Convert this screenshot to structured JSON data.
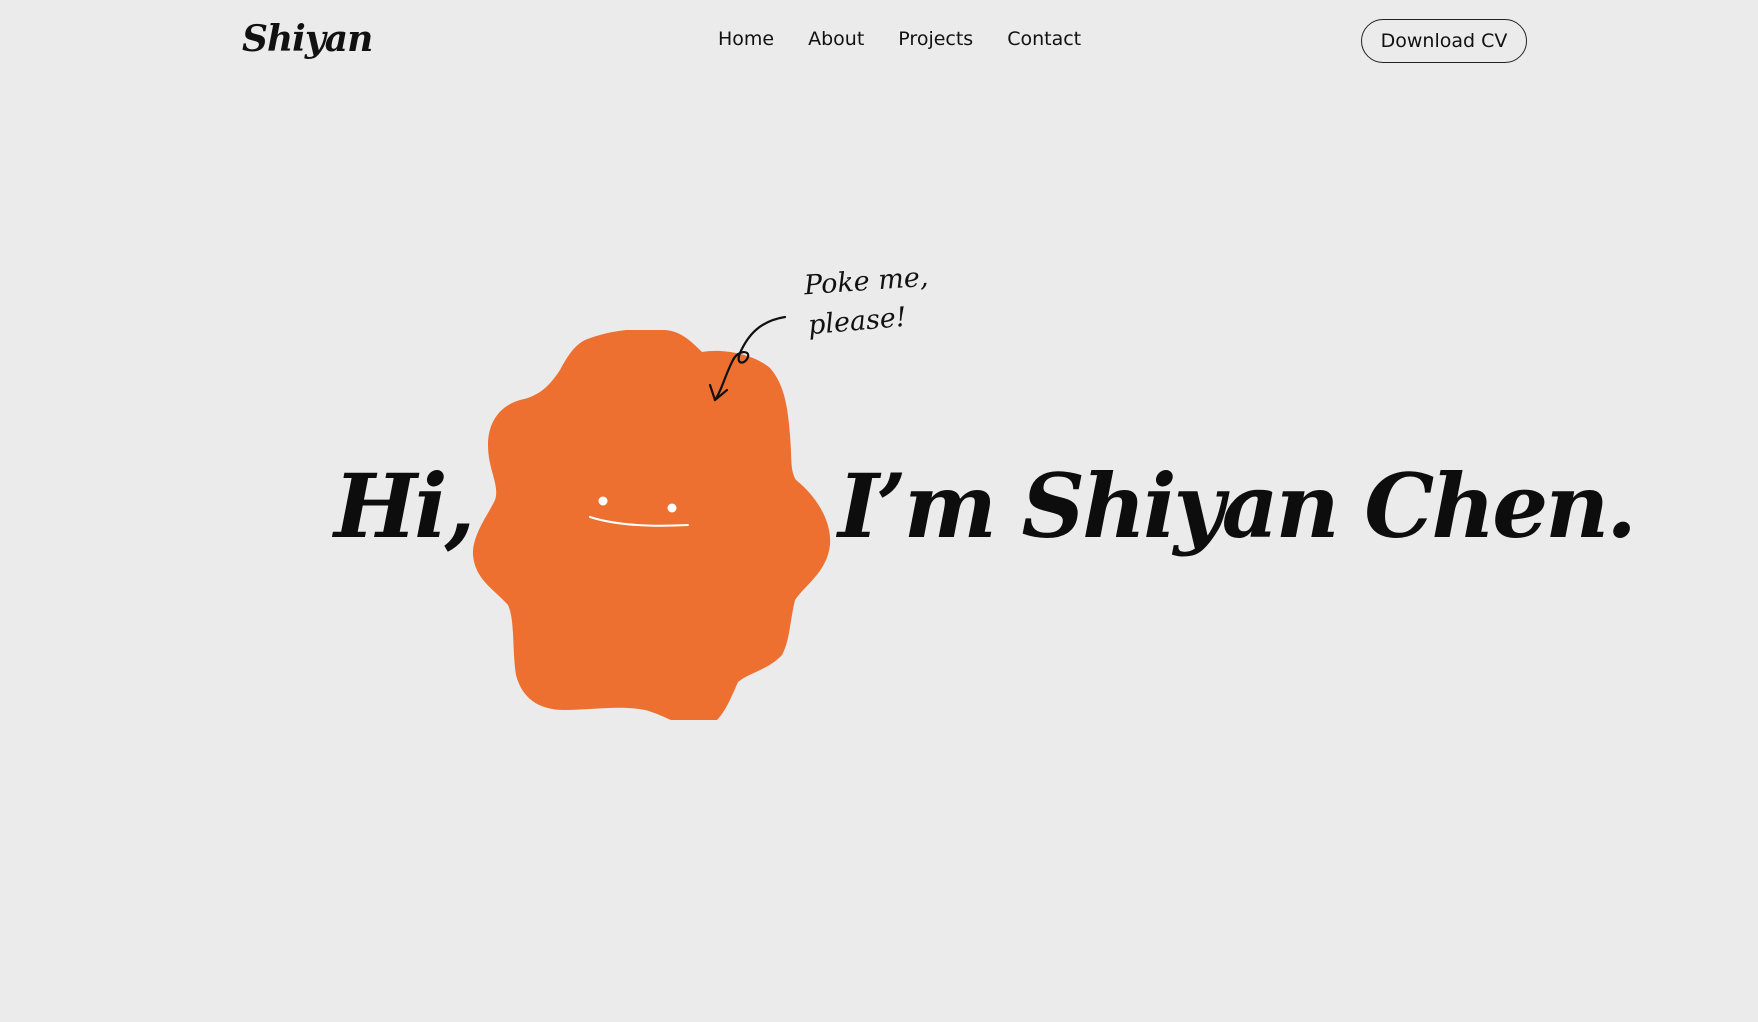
{
  "header": {
    "logo": "Shiyan",
    "nav": [
      "Home",
      "About",
      "Projects",
      "Contact"
    ],
    "cta_label": "Download CV"
  },
  "hero": {
    "greeting": "Hi,",
    "name_line": "I’m Shiyan Chen.",
    "note_line1": "Poke me,",
    "note_line2": "please!"
  },
  "colors": {
    "background": "#ebebeb",
    "blob": "#ed7030",
    "text": "#0d0d0d"
  }
}
